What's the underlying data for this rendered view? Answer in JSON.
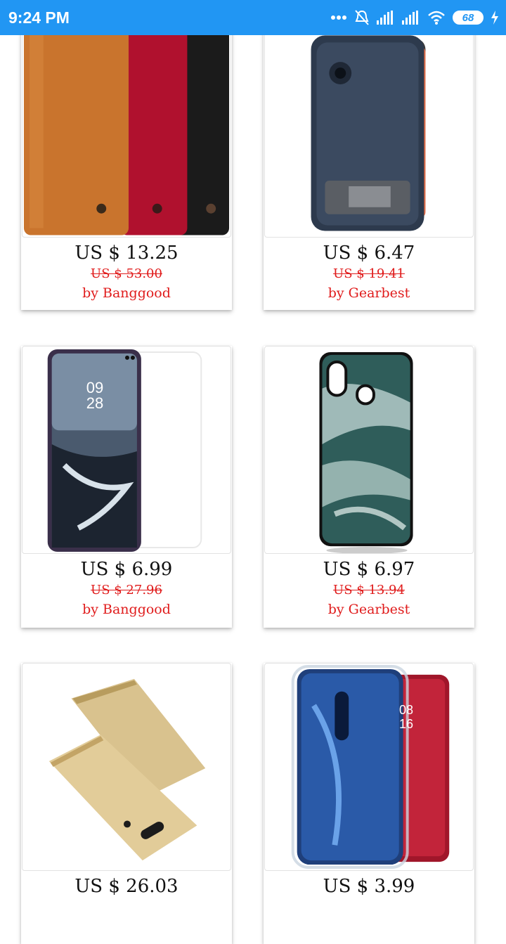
{
  "status_bar": {
    "time": "9:24 PM",
    "battery": "68",
    "icons": [
      "more-dots-icon",
      "mute-bell-icon",
      "signal-icon",
      "signal-icon",
      "wifi-icon",
      "battery-icon",
      "charging-icon"
    ]
  },
  "products": [
    {
      "price": "US $ 13.25",
      "old_price": "US $ 53.00",
      "seller": "by Banggood",
      "image": "leather-flip-cases"
    },
    {
      "price": "US $ 6.47",
      "old_price": "US $ 19.41",
      "seller": "by Gearbest",
      "image": "armor-case"
    },
    {
      "price": "US $ 6.99",
      "old_price": "US $ 27.96",
      "seller": "by Banggood",
      "image": "screen-protector",
      "screen_time": [
        "09",
        "28"
      ]
    },
    {
      "price": "US $ 6.97",
      "old_price": "US $ 13.94",
      "seller": "by Gearbest",
      "image": "ocean-case"
    },
    {
      "price": "US $ 26.03",
      "seller": "",
      "image": "gold-flip-case"
    },
    {
      "price": "US $ 3.99",
      "seller": "",
      "image": "clear-case",
      "screen_time": [
        "08",
        "16"
      ]
    }
  ],
  "colors": {
    "status_bar": "#2196f3",
    "seller_red": "#e01b1b"
  }
}
